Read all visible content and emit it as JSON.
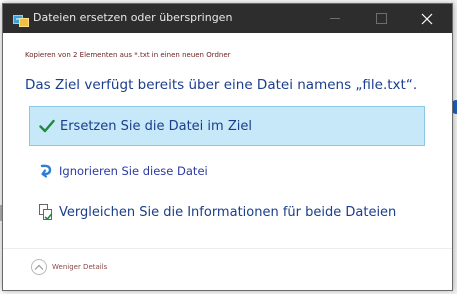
{
  "window": {
    "title": "Dateien ersetzen oder überspringen"
  },
  "dialog": {
    "subtitle": "Kopieren von 2 Elementen aus *.txt in einen neuen Ordner",
    "heading": "Das Ziel verfügt bereits über eine Datei namens „file.txt“.",
    "options": [
      {
        "label": "Ersetzen Sie die Datei im Ziel",
        "icon": "checkmark-icon",
        "selected": true
      },
      {
        "label": "Ignorieren Sie diese Datei",
        "icon": "skip-arrow-icon",
        "selected": false
      },
      {
        "label": "Vergleichen Sie die Informationen für beide Dateien",
        "icon": "compare-files-icon",
        "selected": false
      }
    ],
    "details_label": "Weniger Details"
  },
  "colors": {
    "titlebar": "#2d2d2d",
    "selected_bg": "#c6e8f8",
    "link_blue": "#1a3e8c",
    "check_green": "#1e8a3c"
  }
}
